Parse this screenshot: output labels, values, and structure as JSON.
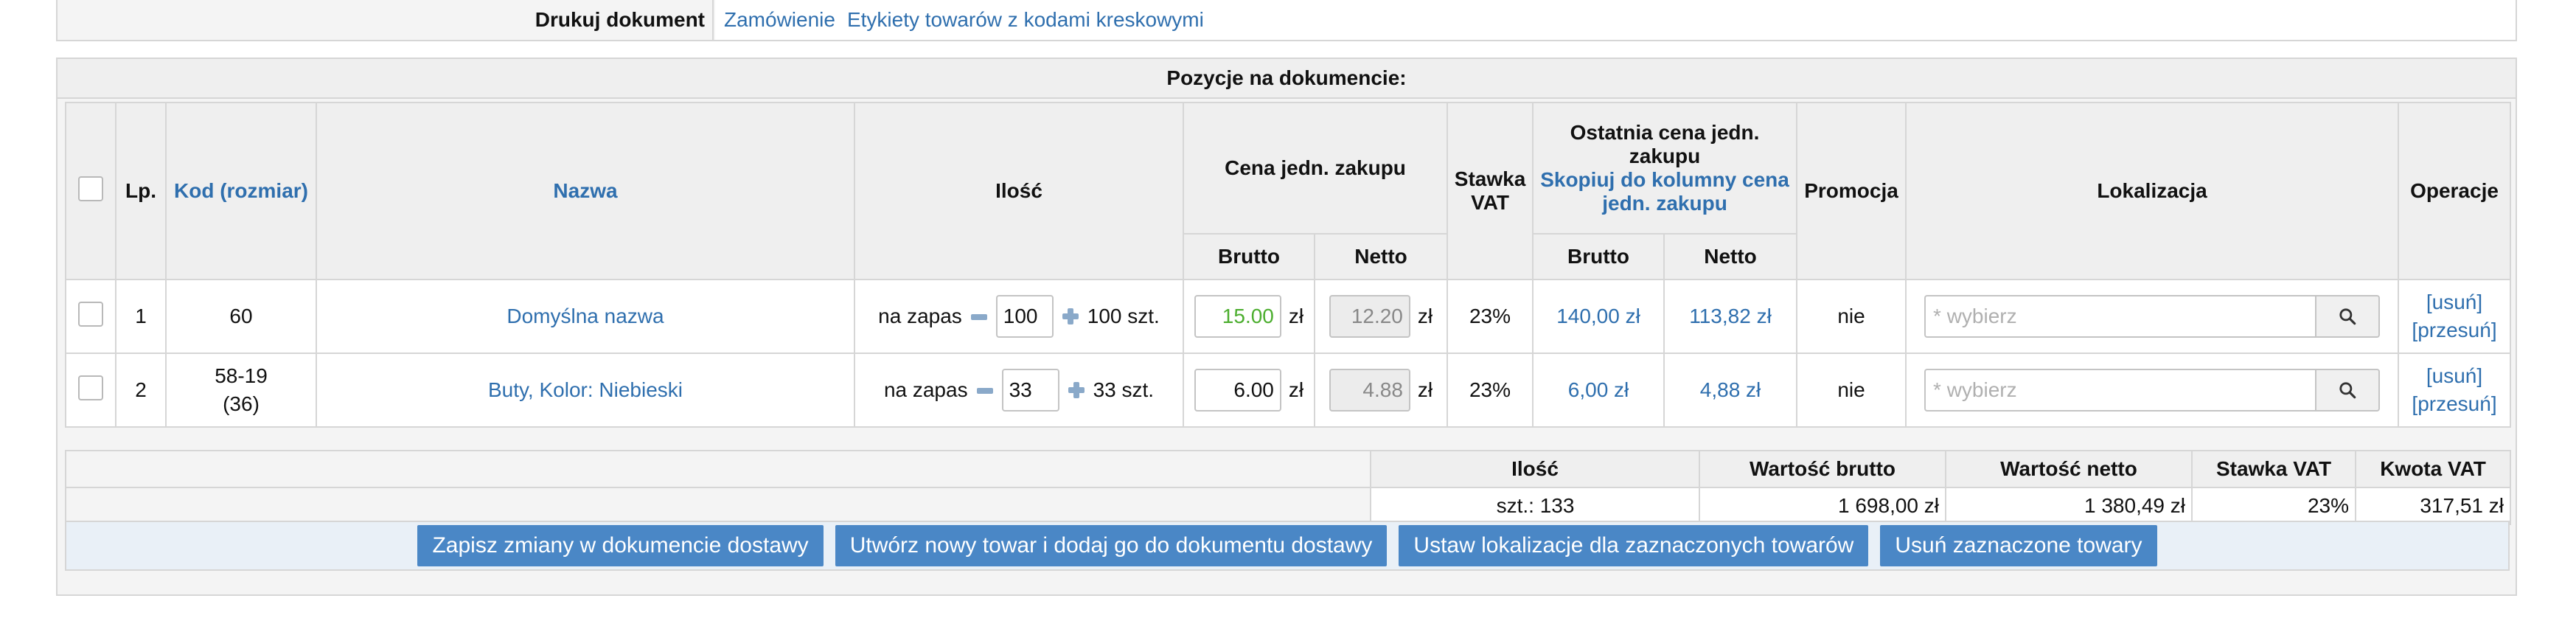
{
  "print": {
    "label": "Drukuj dokument",
    "links": [
      "Zamówienie",
      "Etykiety towarów z kodami kreskowymi"
    ]
  },
  "positions": {
    "title": "Pozycje na dokumencie:",
    "headers": {
      "lp": "Lp.",
      "kod": "Kod (rozmiar)",
      "nazwa": "Nazwa",
      "ilosc": "Ilość",
      "cena": "Cena jedn. zakupu",
      "brutto": "Brutto",
      "netto": "Netto",
      "vat": "Stawka VAT",
      "ostatnia": "Ostatnia cena jedn. zakupu",
      "skopiuj": "Skopiuj do kolumny cena jedn. zakupu",
      "brutto2": "Brutto",
      "netto2": "Netto",
      "promocja": "Promocja",
      "lokalizacja": "Lokalizacja",
      "operacje": "Operacje"
    },
    "rows": [
      {
        "lp": "1",
        "kod": "60",
        "kod_size": "",
        "nazwa": "Domyślna nazwa",
        "na_zapas": "na zapas",
        "qty": "100",
        "qty_text": "100 szt.",
        "brutto": "15.00",
        "zl1": "zł",
        "netto": "12.20",
        "zl2": "zł",
        "vat": "23%",
        "last_brutto": "140,00 zł",
        "last_netto": "113,82 zł",
        "promocja": "nie",
        "loc_placeholder": "* wybierz",
        "op_remove": "[usuń]",
        "op_move": "[przesuń]"
      },
      {
        "lp": "2",
        "kod": "58-19",
        "kod_size": "(36)",
        "nazwa": "Buty, Kolor: Niebieski",
        "na_zapas": "na zapas",
        "qty": "33",
        "qty_text": "33 szt.",
        "brutto": "6.00",
        "zl1": "zł",
        "netto": "4.88",
        "zl2": "zł",
        "vat": "23%",
        "last_brutto": "6,00 zł",
        "last_netto": "4,88 zł",
        "promocja": "nie",
        "loc_placeholder": "* wybierz",
        "op_remove": "[usuń]",
        "op_move": "[przesuń]"
      }
    ]
  },
  "summary": {
    "headers": [
      "Ilość",
      "Wartość brutto",
      "Wartość netto",
      "Stawka VAT",
      "Kwota VAT"
    ],
    "values": [
      "szt.: 133",
      "1 698,00 zł",
      "1 380,49 zł",
      "23%",
      "317,51 zł"
    ]
  },
  "actions": [
    "Zapisz zmiany w dokumencie dostawy",
    "Utwórz nowy towar i dodaj go do dokumentu dostawy",
    "Ustaw lokalizacje dla zaznaczonych towarów",
    "Usuń zaznaczone towary"
  ],
  "colors": {
    "link": "#2f6fae",
    "button": "#4a87c6",
    "price_green": "#4cae2f"
  }
}
